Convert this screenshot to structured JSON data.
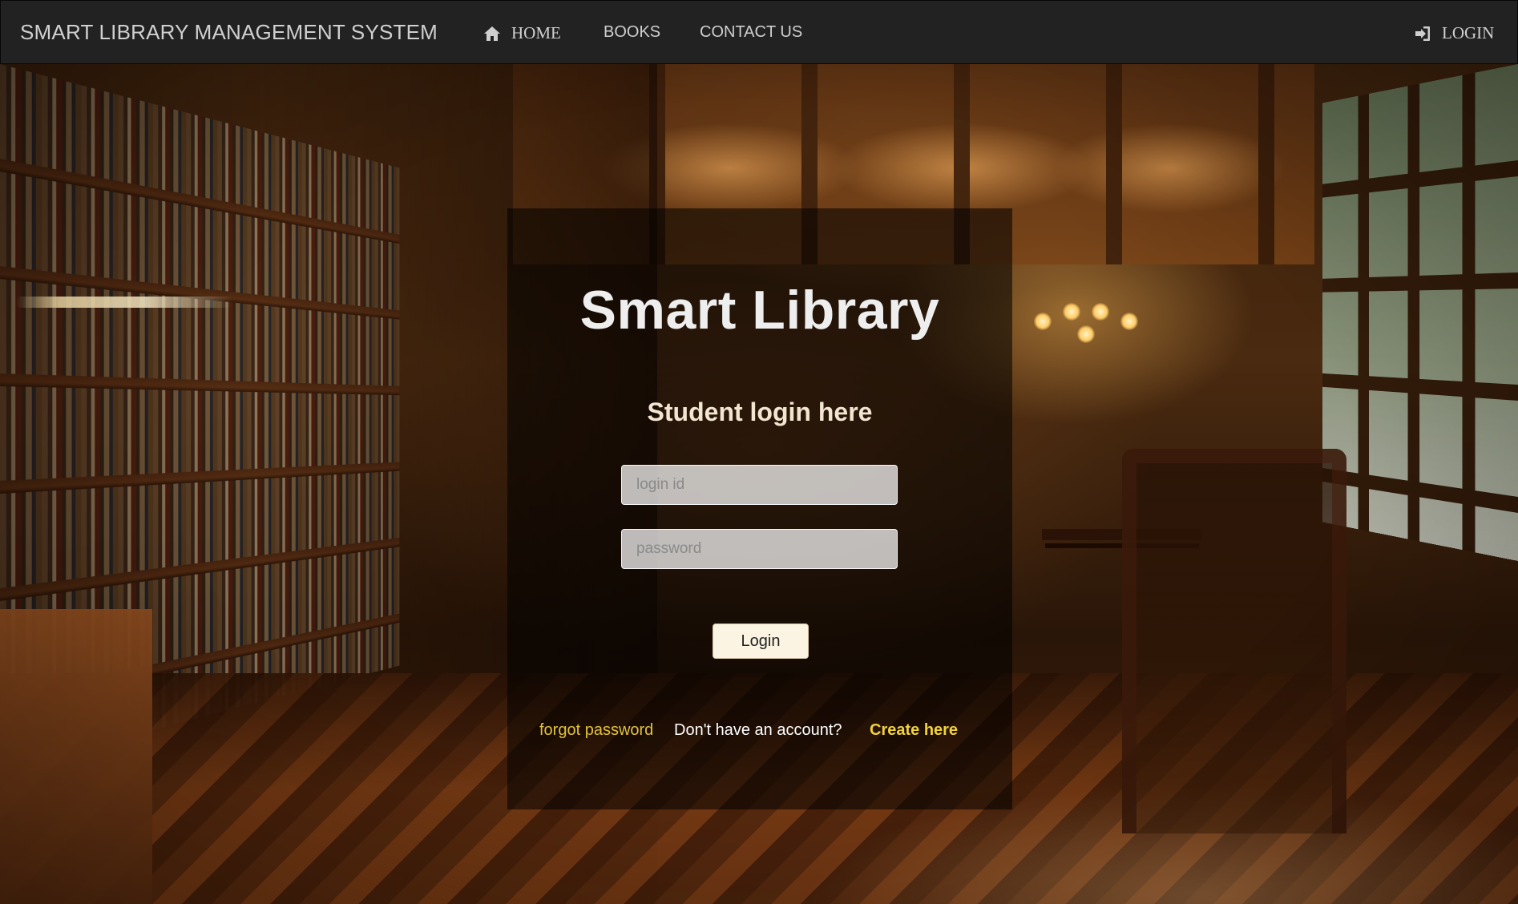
{
  "navbar": {
    "brand": "SMART LIBRARY MANAGEMENT SYSTEM",
    "home_label": "HOME",
    "home_icon": "home-icon",
    "books_label": "BOOKS",
    "contact_label": "CONTACT US",
    "login_label": "LOGIN",
    "login_icon": "sign-in-icon"
  },
  "login_panel": {
    "title": "Smart Library",
    "subtitle": "Student login here",
    "login_id_placeholder": "login id",
    "login_id_value": "",
    "password_placeholder": "password",
    "password_value": "",
    "login_button": "Login",
    "forgot_password": "forgot password",
    "no_account_text": "Don't have an account?",
    "create_link": "Create here"
  },
  "colors": {
    "navbar_bg": "#222222",
    "link_yellow": "#e0c23a",
    "create_yellow": "#f0d23a",
    "panel_overlay": "rgba(0,0,0,0.55)",
    "button_bg": "#fbf4e2"
  },
  "background": {
    "image_subject": "library-interior-photo"
  }
}
